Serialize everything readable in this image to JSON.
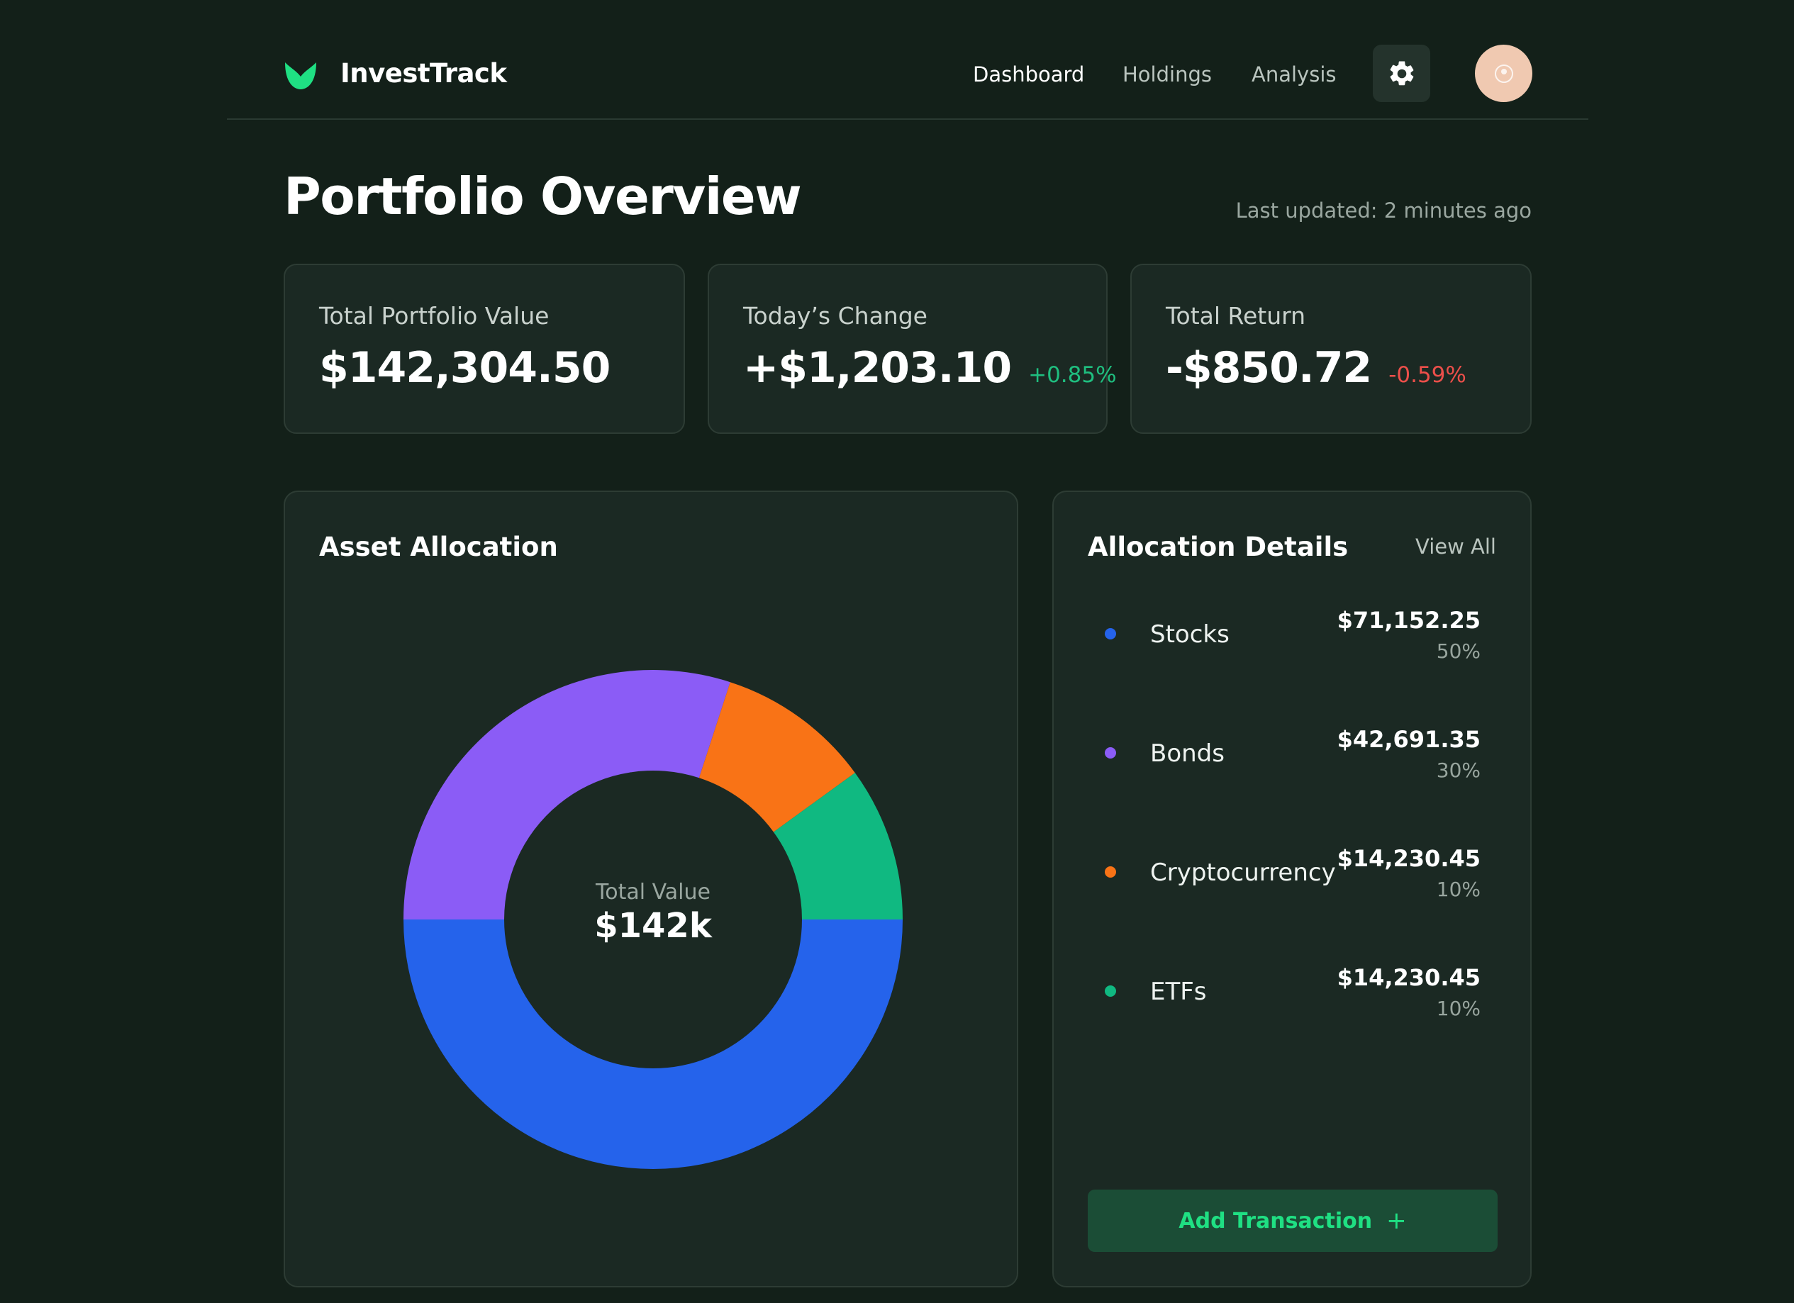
{
  "app": {
    "brand": "InvestTrack",
    "colors": {
      "background": "#132019",
      "card": "#1b2923",
      "accent": "#1fe083",
      "positive": "#1fbe7f",
      "negative": "#ec4f4a"
    }
  },
  "nav": {
    "items": [
      {
        "label": "Dashboard",
        "active": true
      },
      {
        "label": "Holdings",
        "active": false
      },
      {
        "label": "Analysis",
        "active": false
      }
    ],
    "settings_icon": "gear-icon",
    "avatar_icon": "user-avatar"
  },
  "page": {
    "title": "Portfolio Overview",
    "last_updated": "Last updated: 2 minutes ago"
  },
  "stats": {
    "total": {
      "label": "Total Portfolio Value",
      "value": "$142,304.50"
    },
    "change": {
      "label": "Today’s Change",
      "value": "+$1,203.10",
      "pct": "+0.85%"
    },
    "return": {
      "label": "Total Return",
      "value": "-$850.72",
      "pct": "-0.59%"
    }
  },
  "asset_allocation": {
    "title": "Asset Allocation",
    "center_label": "Total Value",
    "center_value": "$142k"
  },
  "chart_data": {
    "type": "pie",
    "categories": [
      "Stocks",
      "Bonds",
      "Cryptocurrency",
      "ETFs"
    ],
    "values": [
      50,
      30,
      10,
      10
    ],
    "colors": [
      "#2563eb",
      "#8b5cf6",
      "#f97316",
      "#10b981"
    ],
    "unit": "%",
    "hole": true
  },
  "details": {
    "title": "Allocation Details",
    "view_all": "View All",
    "items": [
      {
        "name": "Stocks",
        "amount": "$71,152.25",
        "pct": "50%",
        "color": "#2563eb"
      },
      {
        "name": "Bonds",
        "amount": "$42,691.35",
        "pct": "30%",
        "color": "#8b5cf6"
      },
      {
        "name": "Cryptocurrency",
        "amount": "$14,230.45",
        "pct": "10%",
        "color": "#f97316"
      },
      {
        "name": "ETFs",
        "amount": "$14,230.45",
        "pct": "10%",
        "color": "#10b981"
      }
    ],
    "add_button": "Add Transaction",
    "add_icon": "plus-icon"
  }
}
